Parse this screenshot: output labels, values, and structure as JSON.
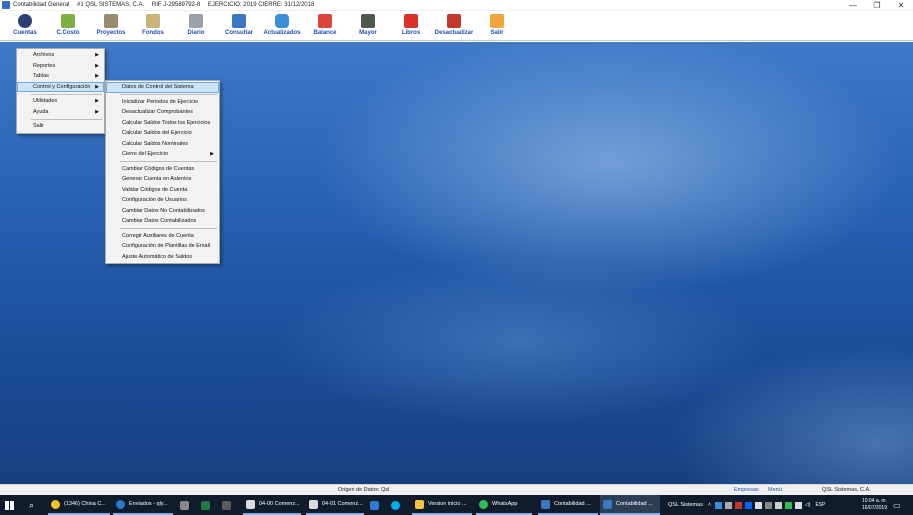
{
  "window": {
    "app_title": "Contabilidad General",
    "company_info": "#1  QSL SISTEMAS, C.A.",
    "rif": "RIF J-29589792-8",
    "ejercicio": "EJERCICIO: 2019 CIERRE: 31/12/2018",
    "minimize": "—",
    "maximize": "❐",
    "close": "✕"
  },
  "toolbar": {
    "items": [
      {
        "label": "Cuentas",
        "icon": "gear-icon",
        "color": "#2b3f73"
      },
      {
        "label": "C.Costo",
        "icon": "plant-icon",
        "color": "#7fb043"
      },
      {
        "label": "Proyectos",
        "icon": "box-icon",
        "color": "#9a8a70"
      },
      {
        "label": "Fondos",
        "icon": "money-icon",
        "color": "#c9b37a"
      },
      {
        "label": "Diario",
        "icon": "paperclip-icon",
        "color": "#9aa0aa"
      },
      {
        "label": "Consultar",
        "icon": "monitor-icon",
        "color": "#3b78c4"
      },
      {
        "label": "Actualizados",
        "icon": "database-icon",
        "color": "#3a8fd6"
      },
      {
        "label": "Balance",
        "icon": "check-icon",
        "color": "#d9453a"
      },
      {
        "label": "Mayor",
        "icon": "ledger-icon",
        "color": "#4d5a4d"
      },
      {
        "label": "Libros",
        "icon": "pdf-icon",
        "color": "#d8322a"
      },
      {
        "label": "Desactualizar",
        "icon": "tools-icon",
        "color": "#c0392b"
      },
      {
        "label": "Salir",
        "icon": "lock-icon",
        "color": "#f2a53a"
      }
    ]
  },
  "main_menu": {
    "items": [
      {
        "label": "Archivos",
        "submenu": true
      },
      {
        "label": "Reportes",
        "submenu": true
      },
      {
        "label": "Tablas",
        "submenu": true
      },
      {
        "label": "Control y Configuración",
        "submenu": true,
        "highlighted": true
      },
      {
        "label": "Utilidades",
        "submenu": true
      },
      {
        "label": "Ayuda",
        "submenu": true
      },
      {
        "label": "Salir",
        "submenu": false
      }
    ]
  },
  "submenu": {
    "items": [
      {
        "label": "Datos de Control del Sistema"
      },
      {
        "label": "Inicializar Periodos de Ejercicio"
      },
      {
        "label": "Desactualizar Comprobantes"
      },
      {
        "label": "Calcular Saldos Todos los Ejercicios"
      },
      {
        "label": "Calcular Saldos del Ejercicio"
      },
      {
        "label": "Calcular Saldos Nominales"
      },
      {
        "label": "Cierre del Ejercicio"
      },
      {
        "label": "Cambiar Códigos de Cuentas"
      },
      {
        "label": "Generar Cuenta en Asientos"
      },
      {
        "label": "Validar Códigos de Cuenta"
      },
      {
        "label": "Configuración de Usuarios"
      },
      {
        "label": "Cambiar Datos No Contabilizados"
      },
      {
        "label": "Cambiar Datos Contabilizados"
      },
      {
        "label": "Corregir Auxiliares de Cuenta"
      },
      {
        "label": "Configuración de Plantillas de Email"
      },
      {
        "label": "Ajuste Automático de Saldos"
      }
    ]
  },
  "status": {
    "origen": "Origen de Datos: Qsl",
    "empresas": "Empresas",
    "menu": "Menú",
    "company": "QSL Sistemas, C.A."
  },
  "taskbar": {
    "items": [
      {
        "label": "(1346) China C...",
        "color": "#f2c12e"
      },
      {
        "label": "Enviados - qly...",
        "color": "#2b7bd4"
      },
      {
        "label": "04-00 Comenz...",
        "color": "#dcdcdc"
      },
      {
        "label": "04-01 Comenz...",
        "color": "#dcdcdc"
      },
      {
        "label": "Version inicio ...",
        "color": "#f5c542"
      },
      {
        "label": "WhatsApp",
        "color": "#2fbe4f"
      },
      {
        "label": "Contabilidad ...",
        "color": "#3b78c4"
      },
      {
        "label": "Contabilidad ...",
        "color": "#3b78c4"
      },
      {
        "label": "QSL Sistemas",
        "color": "#101c2c"
      }
    ],
    "language": "ESP",
    "time": "10:04 a. m.",
    "date": "16/07/2019"
  }
}
